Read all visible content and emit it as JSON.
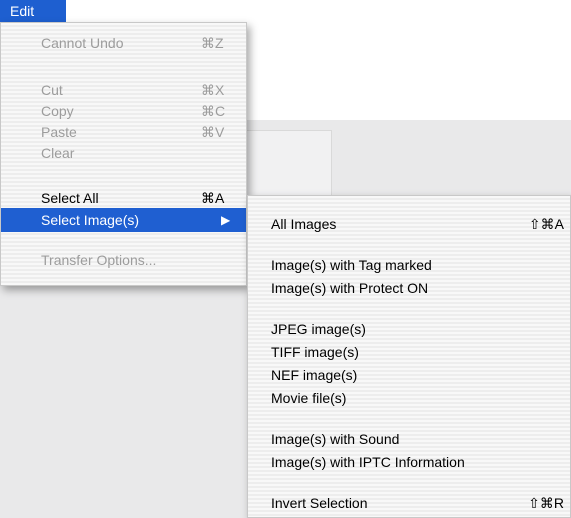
{
  "menubar": {
    "title": "Edit"
  },
  "edit_menu": {
    "items": [
      {
        "label": "Cannot Undo",
        "shortcut": "⌘Z",
        "enabled": false
      },
      {
        "label": "Cut",
        "shortcut": "⌘X",
        "enabled": false
      },
      {
        "label": "Copy",
        "shortcut": "⌘C",
        "enabled": false
      },
      {
        "label": "Paste",
        "shortcut": "⌘V",
        "enabled": false
      },
      {
        "label": "Clear",
        "shortcut": "",
        "enabled": false
      },
      {
        "label": "Select All",
        "shortcut": "⌘A",
        "enabled": true
      },
      {
        "label": "Select Image(s)",
        "shortcut": "▶",
        "enabled": true,
        "highlighted": true
      },
      {
        "label": "Transfer Options...",
        "shortcut": "",
        "enabled": false
      }
    ]
  },
  "select_images_submenu": {
    "items": [
      {
        "label": "All Images",
        "shortcut": "⇧⌘A"
      },
      {
        "label": "Image(s) with Tag marked",
        "shortcut": ""
      },
      {
        "label": "Image(s) with Protect ON",
        "shortcut": ""
      },
      {
        "label": "JPEG image(s)",
        "shortcut": ""
      },
      {
        "label": "TIFF image(s)",
        "shortcut": ""
      },
      {
        "label": "NEF image(s)",
        "shortcut": ""
      },
      {
        "label": "Movie file(s)",
        "shortcut": ""
      },
      {
        "label": "Image(s) with Sound",
        "shortcut": ""
      },
      {
        "label": "Image(s) with IPTC Information",
        "shortcut": ""
      },
      {
        "label": "Invert Selection",
        "shortcut": "⇧⌘R"
      }
    ]
  },
  "colors": {
    "highlight": "#1f5fd1",
    "disabled_text": "#9c9c9c"
  }
}
